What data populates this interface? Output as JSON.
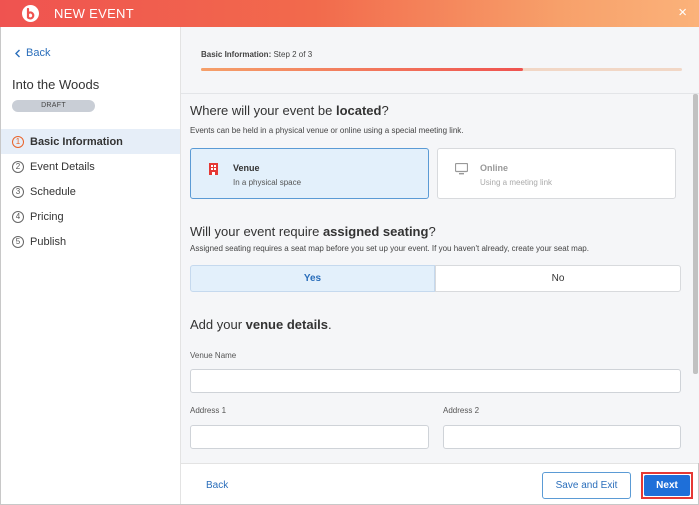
{
  "header": {
    "title": "NEW EVENT",
    "close_label": "×"
  },
  "sidebar": {
    "back_label": "Back",
    "event_name": "Into the Woods",
    "status_badge": "DRAFT",
    "items": [
      {
        "num": "1",
        "label": "Basic Information",
        "active": true
      },
      {
        "num": "2",
        "label": "Event Details",
        "active": false
      },
      {
        "num": "3",
        "label": "Schedule",
        "active": false
      },
      {
        "num": "4",
        "label": "Pricing",
        "active": false
      },
      {
        "num": "5",
        "label": "Publish",
        "active": false
      }
    ]
  },
  "step": {
    "prefix": "Basic Information:",
    "text": " Step 2 of 3",
    "progress_percent": 67
  },
  "location": {
    "heading_pre": "Where will your event be ",
    "heading_bold": "located",
    "heading_post": "?",
    "subtext": "Events can be held in a physical venue or online using a special meeting link.",
    "options": [
      {
        "title": "Venue",
        "desc": "In a physical space",
        "icon": "building-icon",
        "selected": true
      },
      {
        "title": "Online",
        "desc": "Using a meeting link",
        "icon": "monitor-icon",
        "selected": false
      }
    ]
  },
  "seating": {
    "heading_pre": "Will your event require ",
    "heading_bold": "assigned seating",
    "heading_post": "?",
    "subtext": "Assigned seating requires a seat map before you set up your event. If you haven't already, create your seat map.",
    "yes_label": "Yes",
    "no_label": "No",
    "selected": "Yes"
  },
  "venue": {
    "heading_pre": "Add your ",
    "heading_bold": "venue details",
    "heading_post": ".",
    "name_label": "Venue Name",
    "name_value": "",
    "address1_label": "Address 1",
    "address1_value": "",
    "address2_label": "Address 2",
    "address2_value": ""
  },
  "footer": {
    "back_label": "Back",
    "save_exit_label": "Save and Exit",
    "next_label": "Next"
  },
  "colors": {
    "accent": "#1e6fd9",
    "header_start": "#ef5350",
    "header_end": "#fbb27a",
    "selected_bg": "#e3f0fb",
    "highlight": "#e53935"
  }
}
